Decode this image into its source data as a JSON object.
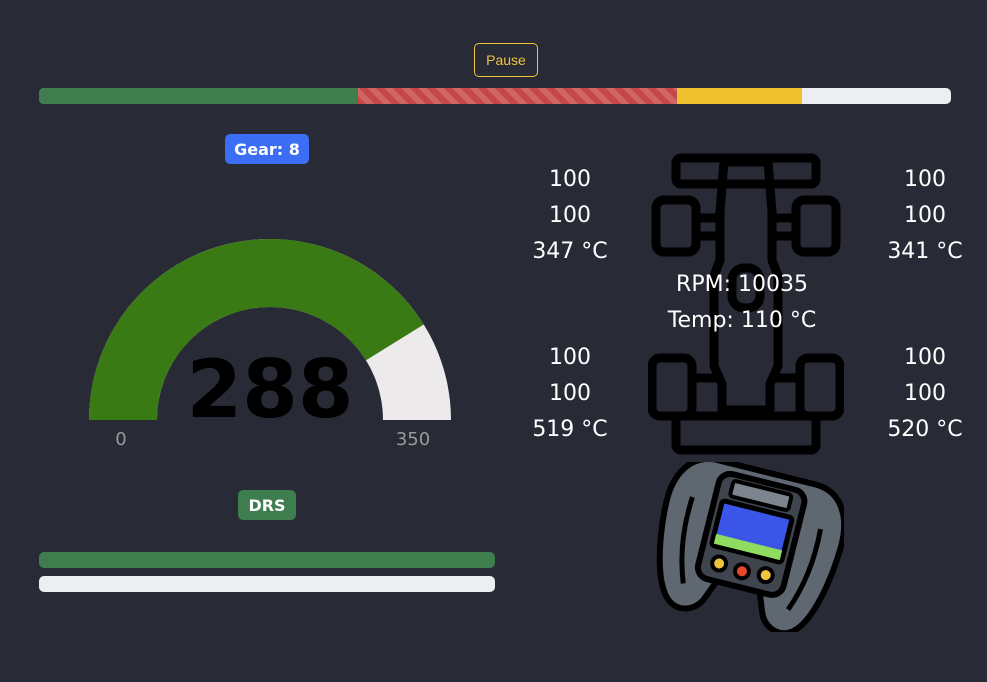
{
  "controls": {
    "pause_label": "Pause"
  },
  "lap_progress": {
    "segments": [
      {
        "name": "green",
        "fraction": 0.35,
        "color": "#3e7d4d"
      },
      {
        "name": "red",
        "fraction": 0.35,
        "color": "#c44848"
      },
      {
        "name": "yellow",
        "fraction": 0.137,
        "color": "#efc12e"
      }
    ]
  },
  "gear": {
    "label": "Gear: 8"
  },
  "speed": {
    "value": "288",
    "min": "0",
    "max": "350",
    "fill_fraction": 0.823,
    "color": "#3a7a14"
  },
  "drs": {
    "label": "DRS"
  },
  "tyres": {
    "front_left": {
      "wear1": "100",
      "wear2": "100",
      "temp": "347 °C"
    },
    "front_right": {
      "wear1": "100",
      "wear2": "100",
      "temp": "341 °C"
    },
    "rear_left": {
      "wear1": "100",
      "wear2": "100",
      "temp": "519 °C"
    },
    "rear_right": {
      "wear1": "100",
      "wear2": "100",
      "temp": "520 °C"
    }
  },
  "engine": {
    "rpm": "RPM: 10035",
    "temp": "Temp: 110 °C"
  },
  "pedals": {
    "throttle": 1.0,
    "brake": 0.0
  },
  "icons": {
    "car": "f1-car-icon",
    "wheel": "steering-wheel-icon"
  }
}
